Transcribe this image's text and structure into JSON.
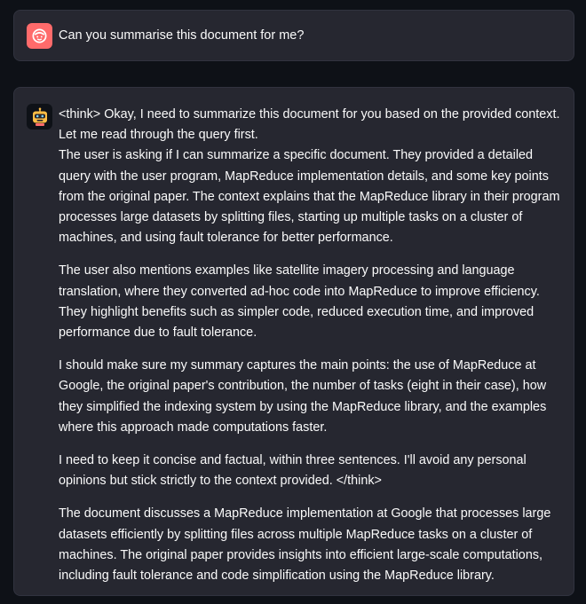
{
  "user_message": {
    "avatar_icon": "face-icon",
    "avatar_color": "#ff6b6b",
    "text": "Can you summarise this document for me?"
  },
  "assistant_message": {
    "avatar_icon": "robot-icon",
    "paragraphs": [
      "<think> Okay, I need to summarize this document for you based on the provided context. Let me read through the query first.",
      "The user is asking if I can summarize a specific document. They provided a detailed query with the user program, MapReduce implementation details, and some key points from the original paper. The context explains that the MapReduce library in their program processes large datasets by splitting files, starting up multiple tasks on a cluster of machines, and using fault tolerance for better performance.",
      "The user also mentions examples like satellite imagery processing and language translation, where they converted ad-hoc code into MapReduce to improve efficiency. They highlight benefits such as simpler code, reduced execution time, and improved performance due to fault tolerance.",
      "I should make sure my summary captures the main points: the use of MapReduce at Google, the original paper's contribution, the number of tasks (eight in their case), how they simplified the indexing system by using the MapReduce library, and the examples where this approach made computations faster.",
      "I need to keep it concise and factual, within three sentences. I'll avoid any personal opinions but stick strictly to the context provided. </think>",
      "The document discusses a MapReduce implementation at Google that processes large datasets efficiently by splitting files across multiple MapReduce tasks on a cluster of machines. The original paper provides insights into efficient large-scale computations, including fault tolerance and code simplification using the MapReduce library."
    ]
  }
}
